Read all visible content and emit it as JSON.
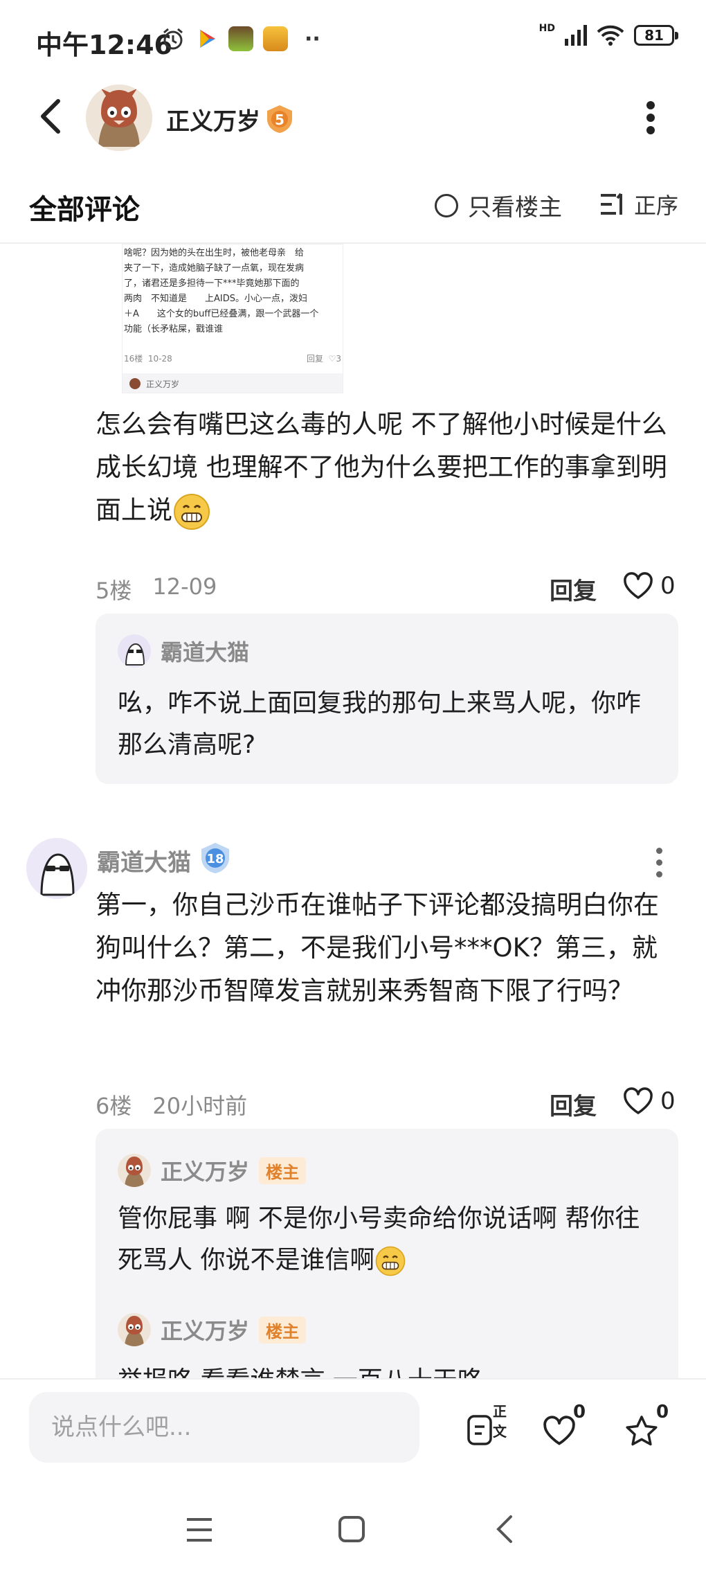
{
  "status_bar": {
    "time": "中午12:46",
    "more": "··",
    "network": "HD",
    "battery": "81"
  },
  "header": {
    "author_name": "正义万岁",
    "level": "5"
  },
  "comments_header": {
    "title": "全部评论",
    "only_op_label": "只看楼主",
    "sort_label": "正序"
  },
  "embedded_image": {
    "lines": [
      "啥呢？因为她的头在出生时，被他老母亲　给",
      "夹了一下，造成她脑子缺了一点氧，现在发病",
      "了，诸君还是多担待一下***毕竟她那下面的",
      "两肉　不知道是　　上AIDS。小心一点，泼妇",
      "＋A　　这个女的buff已经叠满，跟一个武器一个",
      "功能（长矛粘屎，戳谁谁"
    ],
    "floor": "16楼",
    "date": "10-28",
    "reply": "回复",
    "likes": "3",
    "user": "正义万岁"
  },
  "comment_5": {
    "text": "怎么会有嘴巴这么毒的人呢 不了解他小时候是什么成长幻境 也理解不了他为什么要把工作的事拿到明面上说",
    "floor": "5楼",
    "date": "12-09",
    "reply_label": "回复",
    "likes": "0",
    "reply": {
      "name": "霸道大猫",
      "text": "吆，咋不说上面回复我的那句上来骂人呢，你咋那么清高呢?"
    }
  },
  "comment_6": {
    "name": "霸道大猫",
    "level": "18",
    "text": "第一，你自己沙币在谁帖子下评论都没搞明白你在狗叫什么？第二，不是我们小号***OK？第三，就冲你那沙币智障发言就别来秀智商下限了行吗？",
    "floor": "6楼",
    "date": "20小时前",
    "reply_label": "回复",
    "likes": "0",
    "replies": [
      {
        "name": "正义万岁",
        "tag": "楼主",
        "text": "管你屁事 啊 不是你小号卖命给你说话啊 帮你往死骂人 你说不是谁信啊"
      },
      {
        "name": "正义万岁",
        "tag": "楼主",
        "text": "举报咯 看看谁禁言 一百八十天咯"
      }
    ]
  },
  "bottom_bar": {
    "input_placeholder": "说点什么吧...",
    "doc_label": "正文",
    "like_count": "0",
    "fav_count": "0"
  },
  "colors": {
    "accent_orange": "#e0802a",
    "badge_blue": "#4a8fe0",
    "reply_bg": "#f4f4f6",
    "meta_gray": "#8a8a8a"
  },
  "icons": [
    "alarm-icon",
    "play-store-icon",
    "game-app-icon",
    "game-app2-icon",
    "signal-icon",
    "wifi-icon",
    "back-arrow-icon",
    "more-vertical-icon",
    "circle-radio-icon",
    "sort-icon",
    "heart-icon",
    "document-icon",
    "star-icon",
    "menu-icon",
    "home-square-icon",
    "nav-back-icon",
    "grin-emoji-icon"
  ]
}
